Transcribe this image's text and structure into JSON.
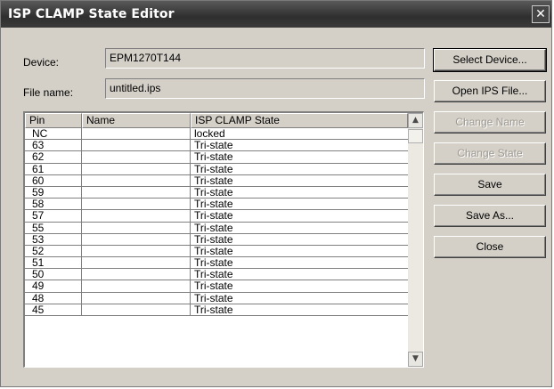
{
  "window": {
    "title": "ISP CLAMP State Editor",
    "close_glyph": "✕"
  },
  "device": {
    "label": "Device:",
    "value": "EPM1270T144"
  },
  "file": {
    "label": "File name:",
    "value": "untitled.ips"
  },
  "table": {
    "headers": [
      "Pin",
      "Name",
      "ISP CLAMP State"
    ],
    "rows": [
      {
        "pin": "NC",
        "name": "",
        "state": "locked"
      },
      {
        "pin": "63",
        "name": "",
        "state": "Tri-state"
      },
      {
        "pin": "62",
        "name": "",
        "state": "Tri-state"
      },
      {
        "pin": "61",
        "name": "",
        "state": "Tri-state"
      },
      {
        "pin": "60",
        "name": "",
        "state": "Tri-state"
      },
      {
        "pin": "59",
        "name": "",
        "state": "Tri-state"
      },
      {
        "pin": "58",
        "name": "",
        "state": "Tri-state"
      },
      {
        "pin": "57",
        "name": "",
        "state": "Tri-state"
      },
      {
        "pin": "55",
        "name": "",
        "state": "Tri-state"
      },
      {
        "pin": "53",
        "name": "",
        "state": "Tri-state"
      },
      {
        "pin": "52",
        "name": "",
        "state": "Tri-state"
      },
      {
        "pin": "51",
        "name": "",
        "state": "Tri-state"
      },
      {
        "pin": "50",
        "name": "",
        "state": "Tri-state"
      },
      {
        "pin": "49",
        "name": "",
        "state": "Tri-state"
      },
      {
        "pin": "48",
        "name": "",
        "state": "Tri-state"
      },
      {
        "pin": "45",
        "name": "",
        "state": "Tri-state"
      }
    ]
  },
  "buttons": {
    "select_device": "Select Device...",
    "open_ips": "Open IPS File...",
    "change_name": "Change Name",
    "change_state": "Change State",
    "save": "Save",
    "save_as": "Save As...",
    "close": "Close"
  },
  "scroll": {
    "up_glyph": "▲",
    "down_glyph": "▼"
  }
}
